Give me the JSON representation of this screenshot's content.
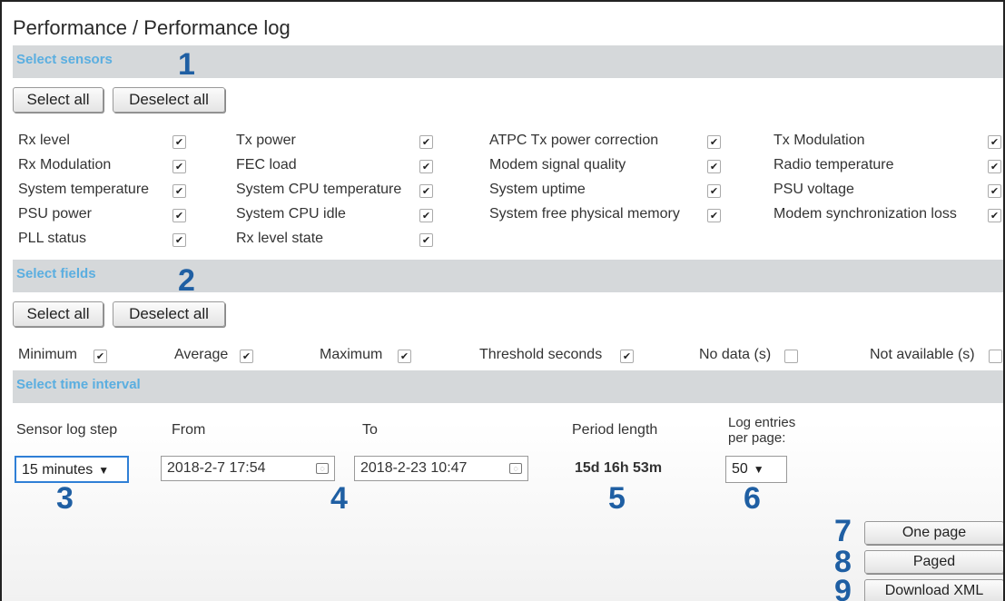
{
  "page_title": "Performance / Performance log",
  "sections": {
    "sensors": "Select sensors",
    "fields": "Select fields",
    "time": "Select time interval"
  },
  "step_numbers": [
    "1",
    "2",
    "3",
    "4",
    "5",
    "6",
    "7",
    "8",
    "9"
  ],
  "buttons": {
    "select_all": "Select all",
    "deselect_all": "Deselect all",
    "one_page": "One page",
    "paged": "Paged",
    "download_xml": "Download XML"
  },
  "sensors": [
    {
      "label": "Rx level",
      "checked": true
    },
    {
      "label": "Tx power",
      "checked": true
    },
    {
      "label": "ATPC Tx power correction",
      "checked": true
    },
    {
      "label": "Tx Modulation",
      "checked": true
    },
    {
      "label": "Rx Modulation",
      "checked": true
    },
    {
      "label": "FEC load",
      "checked": true
    },
    {
      "label": "Modem signal quality",
      "checked": true
    },
    {
      "label": "Radio temperature",
      "checked": true
    },
    {
      "label": "System temperature",
      "checked": true
    },
    {
      "label": "System CPU temperature",
      "checked": true
    },
    {
      "label": "System uptime",
      "checked": true
    },
    {
      "label": "PSU voltage",
      "checked": true
    },
    {
      "label": "PSU power",
      "checked": true
    },
    {
      "label": "System CPU idle",
      "checked": true
    },
    {
      "label": "System free physical memory",
      "checked": true
    },
    {
      "label": "Modem synchronization loss",
      "checked": true
    },
    {
      "label": "PLL status",
      "checked": true
    },
    {
      "label": "Rx level state",
      "checked": true
    }
  ],
  "fields": [
    {
      "label": "Minimum",
      "checked": true
    },
    {
      "label": "Average",
      "checked": true
    },
    {
      "label": "Maximum",
      "checked": true
    },
    {
      "label": "Threshold seconds",
      "checked": true
    },
    {
      "label": "No data (s)",
      "checked": false
    },
    {
      "label": "Not available (s)",
      "checked": false
    }
  ],
  "time": {
    "sensor_log_step_label": "Sensor log step",
    "from_label": "From",
    "to_label": "To",
    "period_label": "Period length",
    "log_entries_label_1": "Log entries",
    "log_entries_label_2": "per page:",
    "sensor_log_step_value": "15 minutes",
    "from_value": "2018-2-7 17:54",
    "to_value": "2018-2-23 10:47",
    "period_value": "15d 16h 53m",
    "log_entries_value": "50"
  },
  "icons": {
    "select_arrow": "▼",
    "calendar": "◌"
  }
}
